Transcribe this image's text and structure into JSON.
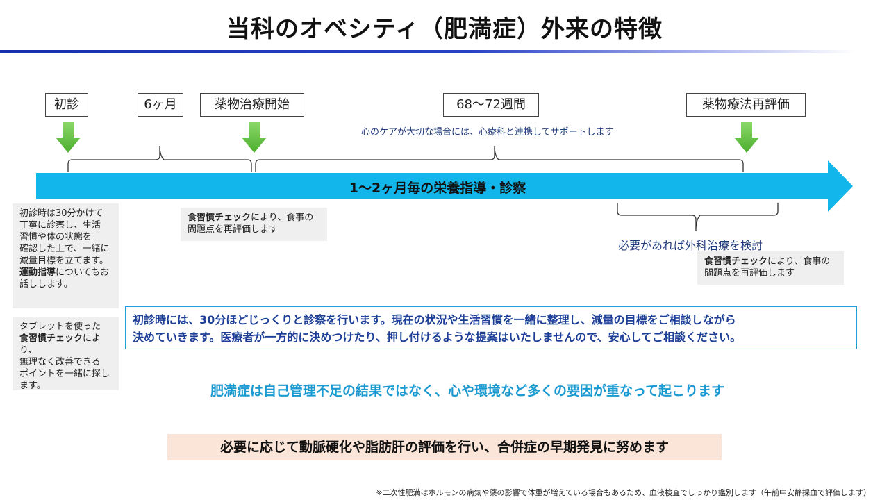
{
  "title": "当科のオベシティ（肥満症）外来の特徴",
  "milestones": {
    "first_visit": "初診",
    "six_months": "6ヶ月",
    "drug_start": "薬物治療開始",
    "weeks": "68〜72週間",
    "re_eval": "薬物療法再評価"
  },
  "care_note": "心のケアが大切な場合には、心療科と連携してサポートします",
  "band_label": "1〜2ヶ月毎の栄養指導・診察",
  "notes": {
    "first_visit": {
      "line1": "初診時は30分かけて",
      "line2": "丁寧に診察し、生活",
      "line3": "習慣や体の状態を",
      "line4": "確認した上で、一緒に",
      "line5": "減量目標を立てます。",
      "bold": "運動指導",
      "line6_rest": "についてもお",
      "line7": "話しします。"
    },
    "tablet": {
      "line1": "タブレットを使った",
      "bold": "食習慣チェック",
      "line2_rest": "により、",
      "line3": "無理なく改善できる",
      "line4": "ポイントを一緒に探し",
      "line5": "ます。"
    },
    "check1": {
      "bold": "食習慣チェック",
      "line1_rest": "により、食事の",
      "line2": "問題点を再評価します"
    },
    "check2": {
      "bold": "食習慣チェック",
      "line1_rest": "により、食事の",
      "line2": "問題点を再評価します"
    }
  },
  "surgery_note": "必要があれば外科治療を検討",
  "main_text": {
    "line1": "初診時には、30分ほどじっくりと診察を行います。現在の状況や生活習慣を一緒に整理し、減量の目標をご相談しながら",
    "line2": "決めていきます。医療者が一方的に決めつけたり、押し付けるような提案はいたしませんので、安心してご相談ください。"
  },
  "cause_text": "肥満症は自己管理不足の結果ではなく、心や環境など多くの要因が重なって起こります",
  "eval_text": "必要に応じて動脈硬化や脂肪肝の評価を行い、合併症の早期発見に努めます",
  "footnote": "※二次性肥満はホルモンの病気や薬の影響で体重が増えている場合もあるため、血液検査でしっかり鑑別します（午前中安静採血で評価します）",
  "colors": {
    "band": "#12b6ea",
    "arrow": "#5cbf3c",
    "title_rule": "#1a2fb0",
    "main_text": "#1c3e96",
    "cause_text": "#1a9ad0",
    "eval_bg": "#fae5d8",
    "note_bg": "#efefef"
  }
}
